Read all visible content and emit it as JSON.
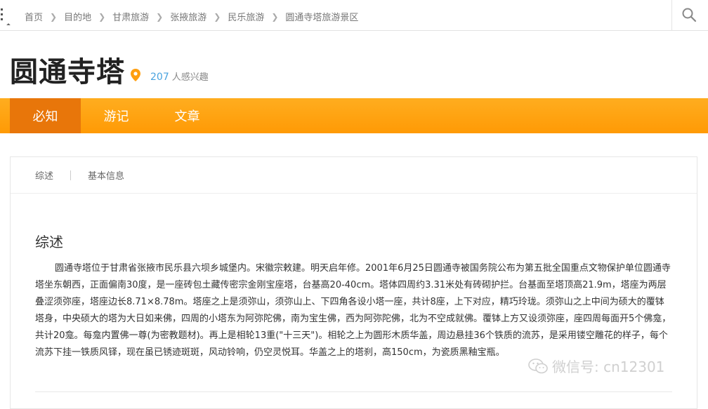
{
  "breadcrumb": [
    "首页",
    "目的地",
    "甘肃旅游",
    "张掖旅游",
    "民乐旅游",
    "圆通寺塔旅游景区"
  ],
  "title": "圆通寺塔",
  "interest": {
    "count": "207",
    "label": "人感兴趣"
  },
  "nav": {
    "tabs": [
      "必知",
      "游记",
      "文章"
    ],
    "active": 0
  },
  "subnav": [
    "综述",
    "基本信息"
  ],
  "section": {
    "title": "综述",
    "body": "圆通寺塔位于甘肃省张掖市民乐县六坝乡城堡内。宋徽宗敕建。明天启年修。2001年6月25日圆通寺被国务院公布为第五批全国重点文物保护单位圆通寺塔坐东朝西，正面偏南30度，是一座砖包土藏传密宗金刚宝座塔，台基高20-40cm。塔体四周约3.31米处有砖砌护拦。台基面至塔顶高21.9m，塔座为两层叠涩须弥座，塔座边长8.71×8.78m。塔座之上是须弥山，须弥山上、下四角各设小塔一座，共计8座，上下对应，精巧玲珑。须弥山之上中间为硕大的覆钵塔身，中央硕大的塔为大日如来佛，四周的小塔东为阿弥陀佛，南为宝生佛，西为阿弥陀佛，北为不空成就佛。覆钵上方又设须弥座，座四周每面开5个佛龛，共计20龛。每龛内置佛一尊(为密教题材)。再上是相轮13重(\"十三天\")。相轮之上为圆形木质华盖，周边悬挂36个铁质的流苏，是采用镂空雕花的样子，每个流苏下挂一铁质风铎，现在虽已锈迹斑斑，风动铃响，仍空灵悦耳。华盖之上的塔刹，高150cm，为瓷质黑釉宝瓶。"
  },
  "watermark": {
    "text": "微信号: cn12301",
    "icon": "wechat-icon"
  },
  "colors": {
    "accent": "#ff9f0f",
    "active_tab": "#e8760a",
    "count": "#4aa3df"
  }
}
